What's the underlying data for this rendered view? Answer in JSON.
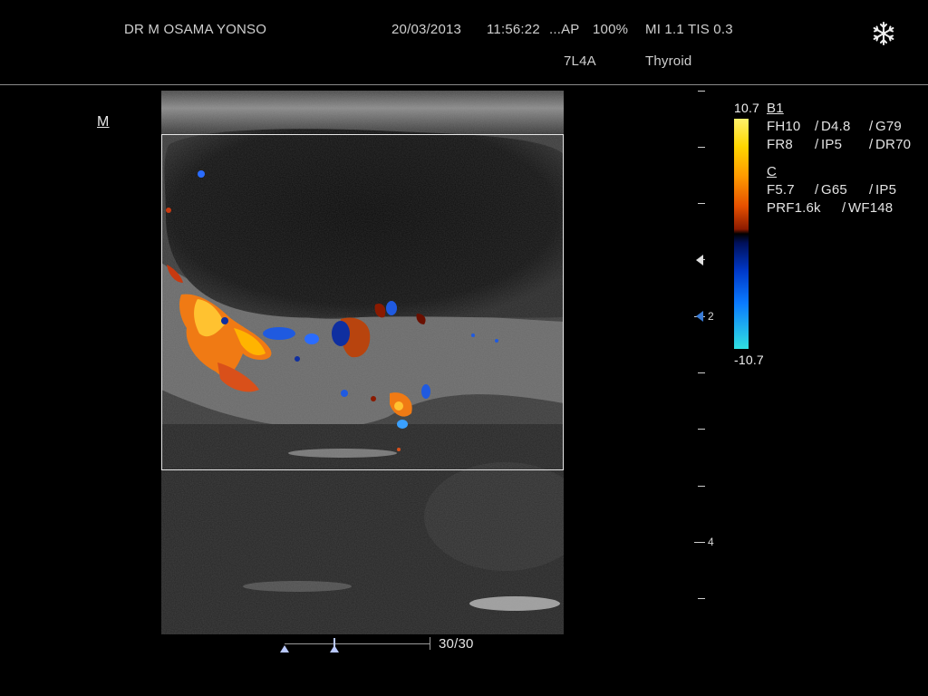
{
  "header": {
    "operator": "DR  M  OSAMA YONSO",
    "date": "20/03/2013",
    "time": "11:56:22",
    "mode": "...AP",
    "power": "100%",
    "mi_tis": "MI 1.1 TIS 0.3",
    "probe": "7L4A",
    "preset": "Thyroid",
    "freeze_icon": "snowflake-icon"
  },
  "orientation_marker": "M",
  "depth_scale": {
    "labels": [
      "2",
      "4"
    ]
  },
  "color_scale": {
    "max": "10.7",
    "min": "-10.7",
    "colors": {
      "top": "#fff26b",
      "positive": "#ff9a00",
      "baseline": "#000000",
      "negative": "#0038c8",
      "bottom": "#30e0e0"
    }
  },
  "params": {
    "b_title": "B1",
    "b_row1": [
      "FH10",
      "D4.8",
      "G79"
    ],
    "b_row2": [
      "FR8",
      "IP5",
      "DR70"
    ],
    "c_title": "C",
    "c_row1": [
      "F5.7",
      "G65",
      "IP5"
    ],
    "c_row2": [
      "PRF1.6k",
      "WF148"
    ]
  },
  "cine": {
    "frame_counter": "30/30"
  }
}
